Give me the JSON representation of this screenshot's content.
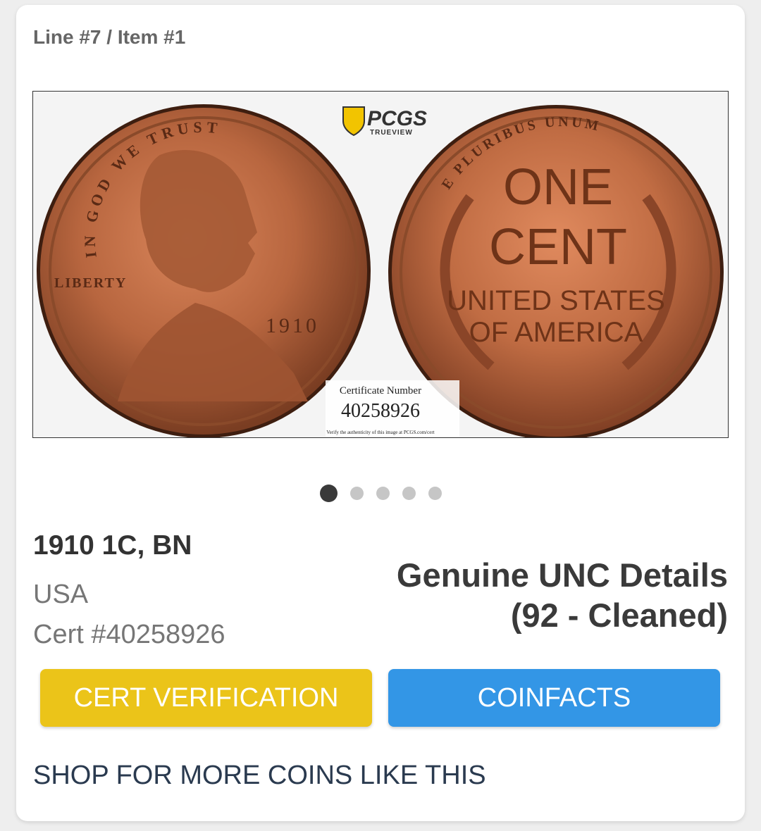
{
  "header": {
    "line_item": "Line #7 / Item #1"
  },
  "image": {
    "logo_text": "PCGS",
    "logo_sub": "TRUEVIEW",
    "obverse": {
      "motto": "IN GOD WE TRUST",
      "liberty": "LIBERTY",
      "year": "1910"
    },
    "reverse": {
      "top_motto": "E PLURIBUS UNUM",
      "denomination_1": "ONE",
      "denomination_2": "CENT",
      "country_1": "UNITED STATES",
      "country_2": "OF AMERICA"
    },
    "cert_label": "Certificate Number",
    "cert_value": "40258926",
    "verify_text": "Verify the authenticity of this image at PCGS.com/cert"
  },
  "carousel": {
    "count": 5,
    "active": 1
  },
  "coin": {
    "title": "1910 1C, BN",
    "country": "USA",
    "cert": "Cert #40258926",
    "grade_line1": "Genuine UNC Details",
    "grade_line2": "(92 - Cleaned)"
  },
  "actions": {
    "cert_verification": "CERT VERIFICATION",
    "coinfacts": "COINFACTS",
    "shop_more": "SHOP FOR MORE COINS LIKE THIS"
  },
  "colors": {
    "cert_button": "#ebc419",
    "coinfacts_button": "#3396e6",
    "shop_link": "#2a3a4f"
  }
}
